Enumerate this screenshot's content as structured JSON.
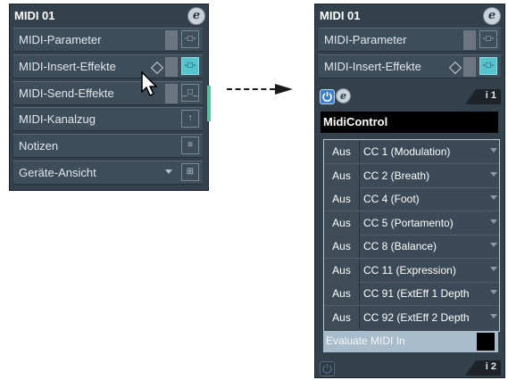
{
  "left_panel": {
    "title": "MIDI 01",
    "rows": [
      {
        "label": "MIDI-Parameter",
        "icon": "midi-parameter-icon"
      },
      {
        "label": "MIDI-Insert-Effekte",
        "icon": "insert-effect-icon"
      },
      {
        "label": "MIDI-Send-Effekte",
        "icon": "send-effect-icon"
      },
      {
        "label": "MIDI-Kanalzug",
        "icon": "channel-strip-icon"
      },
      {
        "label": "Notizen",
        "icon": "notepad-icon"
      },
      {
        "label": "Geräte-Ansicht",
        "icon": "device-panel-icon"
      }
    ]
  },
  "right_panel": {
    "title": "MIDI 01",
    "rows": [
      {
        "label": "MIDI-Parameter"
      },
      {
        "label": "MIDI-Insert-Effekte"
      }
    ],
    "slot1_label": "i 1",
    "slot2_label": "i 2",
    "plugin_name": "MidiControl",
    "cc_rows": [
      {
        "state": "Aus",
        "controller": "CC 1  (Modulation)"
      },
      {
        "state": "Aus",
        "controller": "CC 2  (Breath)"
      },
      {
        "state": "Aus",
        "controller": "CC 4  (Foot)"
      },
      {
        "state": "Aus",
        "controller": "CC 5  (Portamento)"
      },
      {
        "state": "Aus",
        "controller": "CC 8  (Balance)"
      },
      {
        "state": "Aus",
        "controller": "CC 11  (Expression)"
      },
      {
        "state": "Aus",
        "controller": "CC 91  (ExtEff 1 Depth"
      },
      {
        "state": "Aus",
        "controller": "CC 92  (ExtEff 2 Depth"
      }
    ],
    "evaluate_label": "Evaluate MIDI In"
  },
  "colors": {
    "panel_bg": "#33414d",
    "accent_cyan": "#57c3cd",
    "power_blue": "#3c7fd0"
  }
}
